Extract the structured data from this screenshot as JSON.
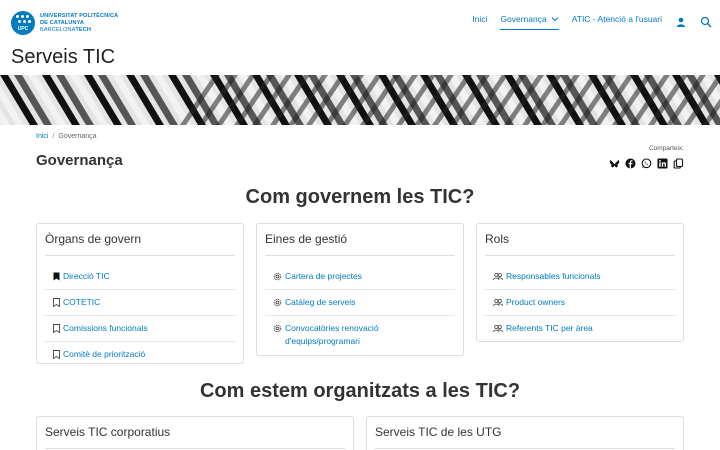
{
  "header": {
    "logo_line1": "UNIVERSITAT POLITÈCNICA",
    "logo_line2": "DE CATALUNYA",
    "logo_line3a": "BARCELONA",
    "logo_line3b": "TECH",
    "logo_mark": "UPC",
    "nav": [
      {
        "label": "Inici"
      },
      {
        "label": "Governança"
      },
      {
        "label": "ATIC - Atenció a l'usuari"
      }
    ],
    "user_icon": "user-icon",
    "search_icon": "search-icon"
  },
  "site_title": "Serveis TIC",
  "breadcrumb": {
    "home": "Inici",
    "sep": "/",
    "current": "Governança"
  },
  "page_title": "Governança",
  "share": {
    "label": "Comparteix:",
    "icons": [
      "bluesky-icon",
      "facebook-icon",
      "whatsapp-icon",
      "linkedin-icon",
      "copy-icon"
    ]
  },
  "section1_title": "Com governem les TIC?",
  "section2_title": "Com estem organitzats a les TIC?",
  "cards": {
    "organs": {
      "title": "Òrgans de govern",
      "items": [
        "Direcció TIC",
        "COTETIC",
        "Comissions funcionals",
        "Comitè de priorització"
      ]
    },
    "eines": {
      "title": "Eines de gestió",
      "items": [
        "Cartera de projectes",
        "Catàleg de serveis",
        "Convocatòries renovació d'equips/programari"
      ]
    },
    "rols": {
      "title": "Rols",
      "items": [
        "Responsables funcionals",
        "Product owners",
        "Referents TIC per àrea"
      ]
    },
    "corporatius": {
      "title": "Serveis TIC corporatius"
    },
    "utg": {
      "title": "Serveis TIC de les UTG"
    }
  },
  "colors": {
    "accent": "#007bc0",
    "text": "#333333",
    "border": "#dddddd"
  }
}
